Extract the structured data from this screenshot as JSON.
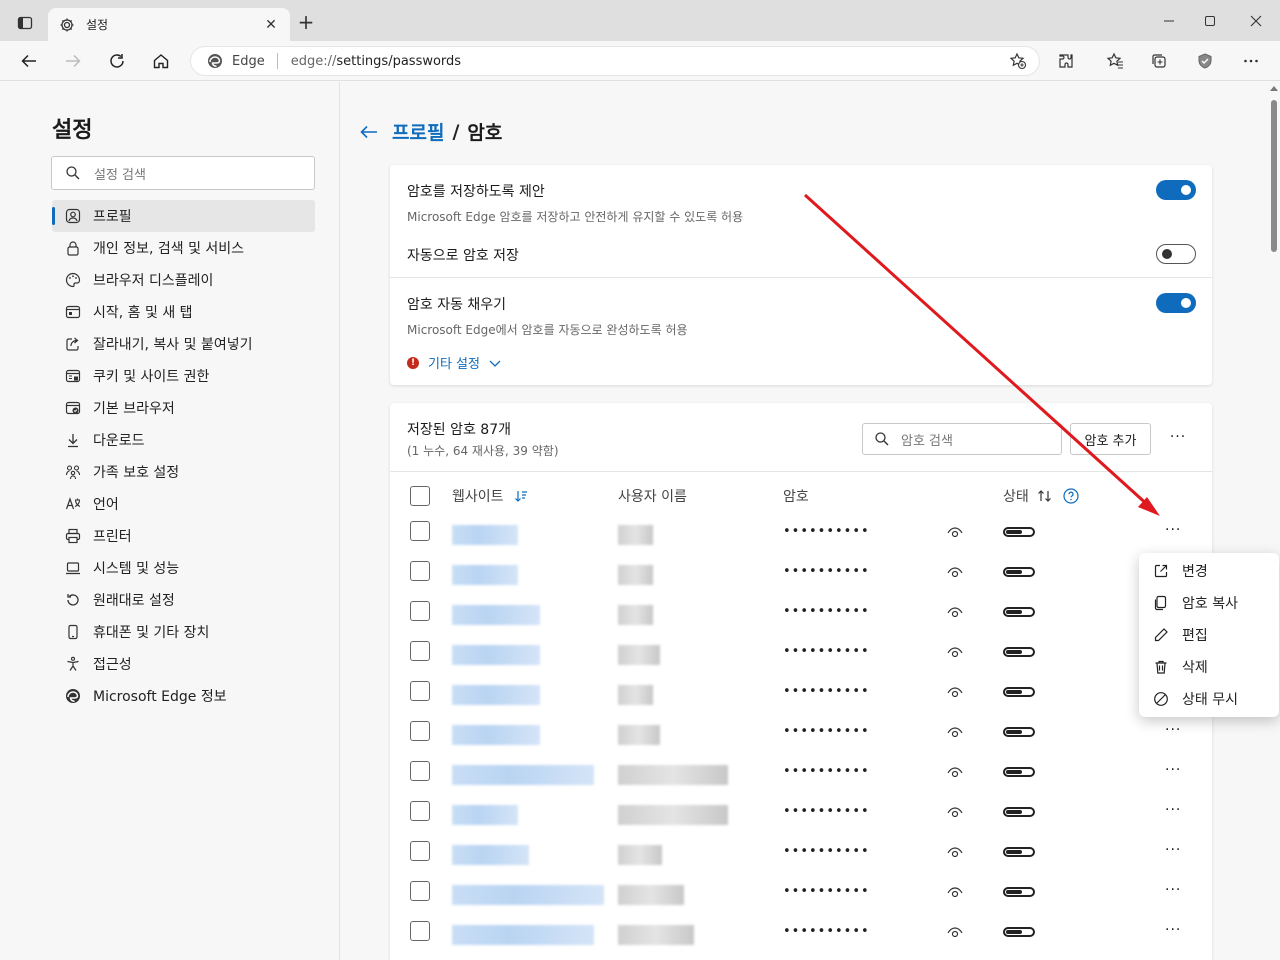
{
  "tab": {
    "title": "설정"
  },
  "address": {
    "site_label": "Edge",
    "url_prefix": "edge://",
    "url_path": "settings/passwords"
  },
  "sidebar": {
    "title": "설정",
    "search_placeholder": "설정 검색",
    "items": [
      {
        "label": "프로필",
        "icon": "profile-icon",
        "active": true
      },
      {
        "label": "개인 정보, 검색 및 서비스",
        "icon": "lock-icon"
      },
      {
        "label": "브라우저 디스플레이",
        "icon": "palette-icon"
      },
      {
        "label": "시작, 홈 및 새 탭",
        "icon": "home-tab-icon"
      },
      {
        "label": "잘라내기, 복사 및 붙여넣기",
        "icon": "share-icon"
      },
      {
        "label": "쿠키 및 사이트 권한",
        "icon": "cookie-icon"
      },
      {
        "label": "기본 브라우저",
        "icon": "browser-icon"
      },
      {
        "label": "다운로드",
        "icon": "download-icon"
      },
      {
        "label": "가족 보호 설정",
        "icon": "family-icon"
      },
      {
        "label": "언어",
        "icon": "language-icon"
      },
      {
        "label": "프린터",
        "icon": "printer-icon"
      },
      {
        "label": "시스템 및 성능",
        "icon": "laptop-icon"
      },
      {
        "label": "원래대로 설정",
        "icon": "reset-icon"
      },
      {
        "label": "휴대폰 및 기타 장치",
        "icon": "phone-icon"
      },
      {
        "label": "접근성",
        "icon": "accessibility-icon"
      },
      {
        "label": "Microsoft Edge 정보",
        "icon": "edge-logo-icon"
      }
    ]
  },
  "breadcrumb": {
    "parent": "프로필",
    "separator": "/",
    "current": "암호"
  },
  "settings": {
    "offer_save": {
      "title": "암호를 저장하도록 제안",
      "desc": "Microsoft Edge 암호를 저장하고 안전하게 유지할 수 있도록 허용",
      "on": true
    },
    "auto_save": {
      "title": "자동으로 암호 저장",
      "on": false
    },
    "autofill": {
      "title": "암호 자동 채우기",
      "desc": "Microsoft Edge에서 암호를 자동으로 완성하도록 허용",
      "on": true
    },
    "more_settings": "기타 설정"
  },
  "passwords": {
    "title": "저장된 암호 87개",
    "subtitle": "(1 누수, 64 재사용, 39 약함)",
    "search_placeholder": "암호 검색",
    "add_button": "암호 추가",
    "columns": {
      "website": "웹사이트",
      "username": "사용자 이름",
      "password": "암호",
      "status": "상태"
    },
    "masked_password": "••••••••••",
    "row_count": 11
  },
  "context_menu": {
    "items": [
      {
        "label": "변경",
        "icon": "open-external-icon"
      },
      {
        "label": "암호 복사",
        "icon": "copy-icon"
      },
      {
        "label": "편집",
        "icon": "pencil-icon"
      },
      {
        "label": "삭제",
        "icon": "trash-icon"
      },
      {
        "label": "상태 무시",
        "icon": "block-icon"
      }
    ]
  },
  "colors": {
    "accent": "#0f6cbd",
    "annotation_arrow": "#e0191e",
    "warning": "#c42b1c"
  }
}
